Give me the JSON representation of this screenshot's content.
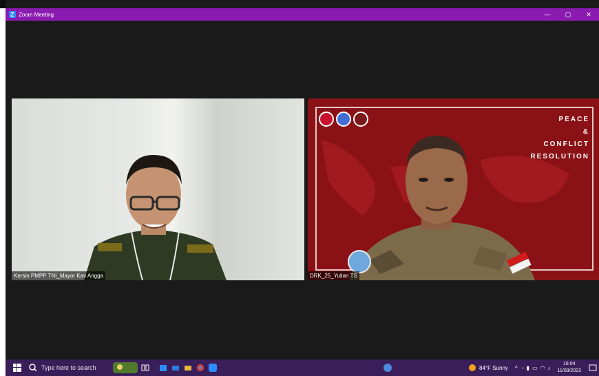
{
  "window": {
    "title": "Zoom Meeting",
    "app_initial": "Z"
  },
  "participants": [
    {
      "name": "Kersin PMPP TNI_Mayor Kav Angga"
    },
    {
      "name": "DRK_25_Yulian TS"
    }
  ],
  "background_banner": {
    "line1": "PEACE",
    "line2": "&",
    "line3": "CONFLICT",
    "line4": "RESOLUTION"
  },
  "taskbar": {
    "search_placeholder": "Type here to search",
    "weather": "84°F  Sunny",
    "time": "16:04",
    "date": "11/09/2023"
  },
  "colors": {
    "title_bar": "#8b1ab0",
    "taskbar": "#3a1e5a",
    "banner_red": "#8a1216"
  }
}
